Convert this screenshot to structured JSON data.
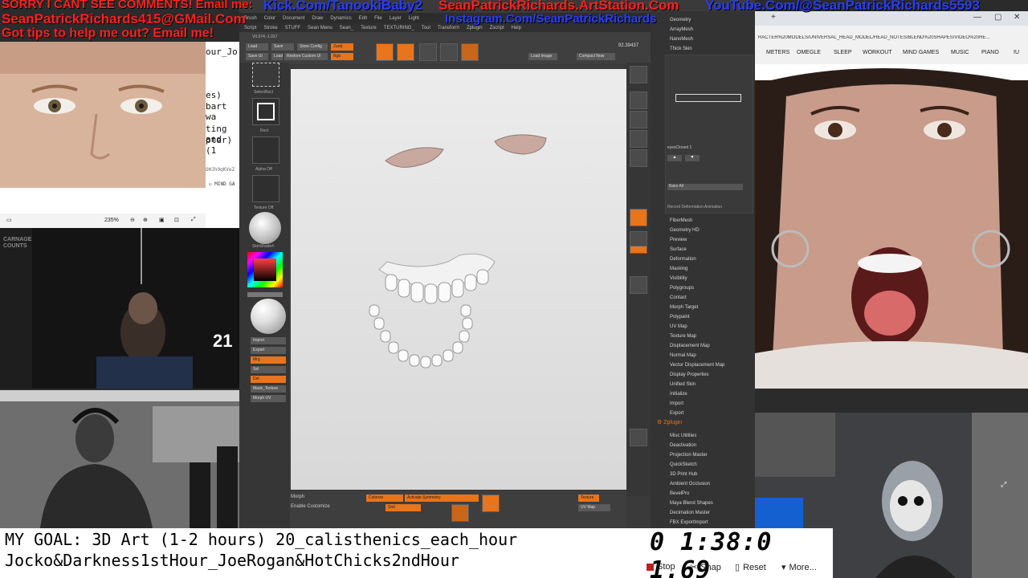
{
  "banner": {
    "apology": "SORRY I CANT SEE COMMENTS! Email me:",
    "kick": "Kick.Com/TanookiBaby2",
    "artstation": "SeanPatrickRichards.ArtStation.Com",
    "youtube": "YouTube.Com/@SeanPatrickRichards5593",
    "email": "SeanPatrickRichards415@GMail.Com",
    "instagram": "Instagram.Com/SeanPatrickRichards",
    "tips": "Got tips to help me out? Email me!"
  },
  "viewer": {
    "zoom": "235%"
  },
  "overlay_number": "21",
  "editor_snippet": {
    "lines": [
      "our_Jo",
      "es)",
      "bart wa",
      "ting and",
      "pter) (1"
    ],
    "url_fragment": "OHJh9qKVeZ",
    "folder": "MIND GA"
  },
  "zbrush": {
    "menu": [
      "Brush",
      "Color",
      "Document",
      "Draw",
      "Dynamics",
      "Edit",
      "File",
      "Layer",
      "Light"
    ],
    "menu2": [
      "Script",
      "Stroke",
      "STUFF",
      "Sean Menu",
      "Sean_",
      "Texture",
      "TEXTURING_",
      "Tool",
      "Transform",
      "Zplugin",
      "Zscript",
      "Help"
    ],
    "top_buttons": [
      "Load",
      "Save",
      "Store Config",
      "Zadd",
      "Save UI",
      "Load",
      "Restore Custom UI",
      "Rgb"
    ],
    "coords": "92.39437",
    "coords2": "V0.074,-1.017",
    "left_labels": [
      "SelectRect",
      "Rect",
      "Alpha Off",
      "Texture Off",
      "SkinShade4",
      "Import",
      "Export",
      "Mrg",
      "Sel",
      "Del",
      "Mask_Texture",
      "Morph UV"
    ],
    "tray_top": [
      "Geometry",
      "ArrayMesh",
      "NanoMesh",
      "Thick Skin"
    ],
    "layers": {
      "eyes_label": "eyesClosed 1",
      "bake": "Bake All",
      "record": "Record Deformation Animation"
    },
    "tray_menu": [
      "FiberMesh",
      "Geometry HD",
      "Preview",
      "Surface",
      "Deformation",
      "Masking",
      "Visibility",
      "Polygroups",
      "Contact",
      "Morph Target",
      "Polypaint",
      "UV Map",
      "Texture Map",
      "Displacement Map",
      "Normal Map",
      "Vector Displacement Map",
      "Display Properties",
      "Unified Skin",
      "Initialize",
      "Import",
      "Export"
    ],
    "zplugin": "Zplugin",
    "plugin_items": [
      "Misc Utilities",
      "Deactivation",
      "Projection Master",
      "QuickSketch",
      "3D Print Hub",
      "Ambient Occlusion",
      "BevelPro",
      "Maya Blend Shapes",
      "Decimation Master",
      "FBX ExportImport"
    ],
    "bottom_labels": [
      "Morph",
      "Enable Customize",
      "Colorize",
      "Activate Symmetry",
      "Smt",
      "Texture",
      "UV Map"
    ]
  },
  "browser": {
    "url": "RACTER%20MODELS/UNIVERSAL_HEAD_MODEL/HEAD_NOTES/BLEND%20SHAPES/VIDEO%20RE...",
    "bookmarks": [
      "METERS",
      "OMEGLE",
      "SLEEP",
      "WORKOUT",
      "MIND GAMES",
      "MUSIC",
      "PIANO",
      "IU"
    ]
  },
  "goal": {
    "line1": "MY GOAL: 3D Art (1-2 hours) 20_calisthenics_each_hour",
    "line2": "Jocko&Darkness1stHour_JoeRogan&HotChicks2ndHour"
  },
  "timer": {
    "value": "0 1:38:0 1.69",
    "stop": "Stop",
    "snap": "Snap",
    "reset": "Reset",
    "more": "More..."
  },
  "colors": {
    "accent": "#e8741b",
    "banner_red": "#ff2020",
    "banner_blue": "#2a3cff"
  }
}
